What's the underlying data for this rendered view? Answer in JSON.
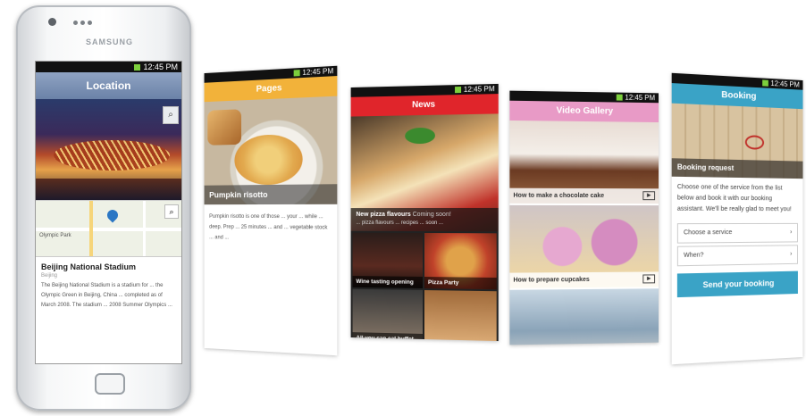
{
  "status_time": "12:45 PM",
  "colors": {
    "location_header": "#7a8fb3",
    "pages_header": "#f2b23a",
    "news_header": "#e0252b",
    "video_header": "#e89ac6",
    "booking_header": "#3aa3c6"
  },
  "phone": {
    "brand": "SAMSUNG",
    "screen": {
      "title": "Location",
      "zoom_icon": "magnifier-icon",
      "place_name": "Beijing National Stadium",
      "place_sub": "Beijing",
      "map_label": "Olympic Park",
      "body": "The Beijing National Stadium is a stadium for ... the Olympic Green in Beijing, China ... completed as of March 2008. The stadium ... 2008 Summer Olympics ..."
    }
  },
  "pages": {
    "header": "Pages",
    "caption": "Pumpkin risotto",
    "text": "Pumpkin risotto is one of those ... your ... while ... deep. Prep ... 25 minutes ... and ... vegetable stock ... and ..."
  },
  "news": {
    "header": "News",
    "headline": "New pizza flavours",
    "headline_tag": "Coming soon!",
    "headline_desc": "... pizza flavours ... recipes ... soon ...",
    "tiles": [
      {
        "label": "Wine tasting opening"
      },
      {
        "label": "Pizza Party"
      },
      {
        "label": "All you can eat buffet"
      },
      {
        "label": ""
      }
    ]
  },
  "video": {
    "header": "Video Gallery",
    "items": [
      {
        "caption": "How to make a chocolate cake"
      },
      {
        "caption": "How to prepare cupcakes"
      },
      {
        "caption": ""
      }
    ]
  },
  "booking": {
    "header": "Booking",
    "subheader": "Booking request",
    "text": "Choose one of the service from the list below and book it with our booking assistant. We'll be really glad to meet you!",
    "field1": "Choose a service",
    "field2": "When?",
    "button": "Send your booking"
  }
}
